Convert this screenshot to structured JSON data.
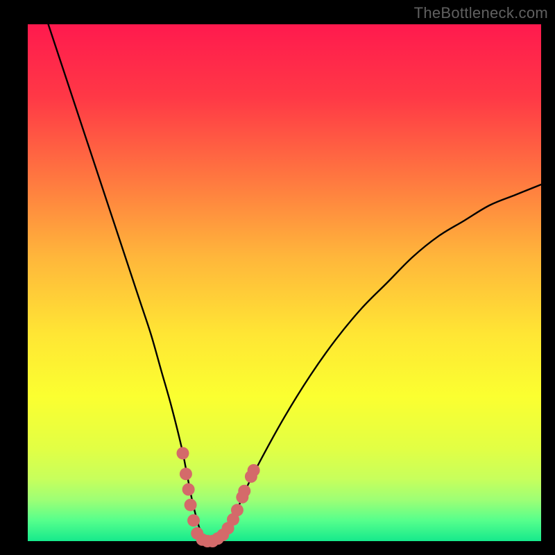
{
  "watermark": "TheBottleneck.com",
  "chart_data": {
    "type": "line",
    "title": "",
    "xlabel": "",
    "ylabel": "",
    "xlim": [
      0,
      100
    ],
    "ylim": [
      0,
      100
    ],
    "background_gradient_stops": [
      {
        "offset": 0,
        "color": "#ff1a4e"
      },
      {
        "offset": 14,
        "color": "#ff3846"
      },
      {
        "offset": 30,
        "color": "#ff7840"
      },
      {
        "offset": 45,
        "color": "#ffb63b"
      },
      {
        "offset": 60,
        "color": "#ffe634"
      },
      {
        "offset": 72,
        "color": "#fbff30"
      },
      {
        "offset": 82,
        "color": "#e2ff44"
      },
      {
        "offset": 88,
        "color": "#c7ff5c"
      },
      {
        "offset": 92,
        "color": "#9eff75"
      },
      {
        "offset": 96,
        "color": "#56ff8c"
      },
      {
        "offset": 100,
        "color": "#16e98c"
      }
    ],
    "series": [
      {
        "name": "bottleneck-curve",
        "color": "#000000",
        "x": [
          4,
          6,
          8,
          10,
          12,
          14,
          16,
          18,
          20,
          22,
          24,
          26,
          28,
          30,
          31,
          32,
          33,
          34,
          35,
          36,
          37,
          38,
          40,
          42,
          45,
          50,
          55,
          60,
          65,
          70,
          75,
          80,
          85,
          90,
          95,
          100
        ],
        "y": [
          100,
          94,
          88,
          82,
          76,
          70,
          64,
          58,
          52,
          46,
          40,
          33,
          26,
          18,
          13,
          8,
          4,
          1,
          0,
          0,
          0,
          1,
          4,
          9,
          15,
          24,
          32,
          39,
          45,
          50,
          55,
          59,
          62,
          65,
          67,
          69
        ]
      }
    ],
    "markers": {
      "name": "highlight-dots",
      "color": "#d46a6a",
      "radius": 9,
      "points": [
        {
          "x": 30.2,
          "y": 17
        },
        {
          "x": 30.8,
          "y": 13
        },
        {
          "x": 31.3,
          "y": 10
        },
        {
          "x": 31.7,
          "y": 7
        },
        {
          "x": 32.3,
          "y": 4
        },
        {
          "x": 33.0,
          "y": 1.5
        },
        {
          "x": 34.0,
          "y": 0.3
        },
        {
          "x": 35.0,
          "y": 0
        },
        {
          "x": 36.0,
          "y": 0
        },
        {
          "x": 37.0,
          "y": 0.5
        },
        {
          "x": 38.0,
          "y": 1.2
        },
        {
          "x": 39.0,
          "y": 2.5
        },
        {
          "x": 40.0,
          "y": 4.2
        },
        {
          "x": 40.8,
          "y": 6.0
        },
        {
          "x": 41.8,
          "y": 8.5
        },
        {
          "x": 42.2,
          "y": 9.7
        },
        {
          "x": 43.5,
          "y": 12.5
        },
        {
          "x": 44.0,
          "y": 13.7
        }
      ]
    }
  }
}
